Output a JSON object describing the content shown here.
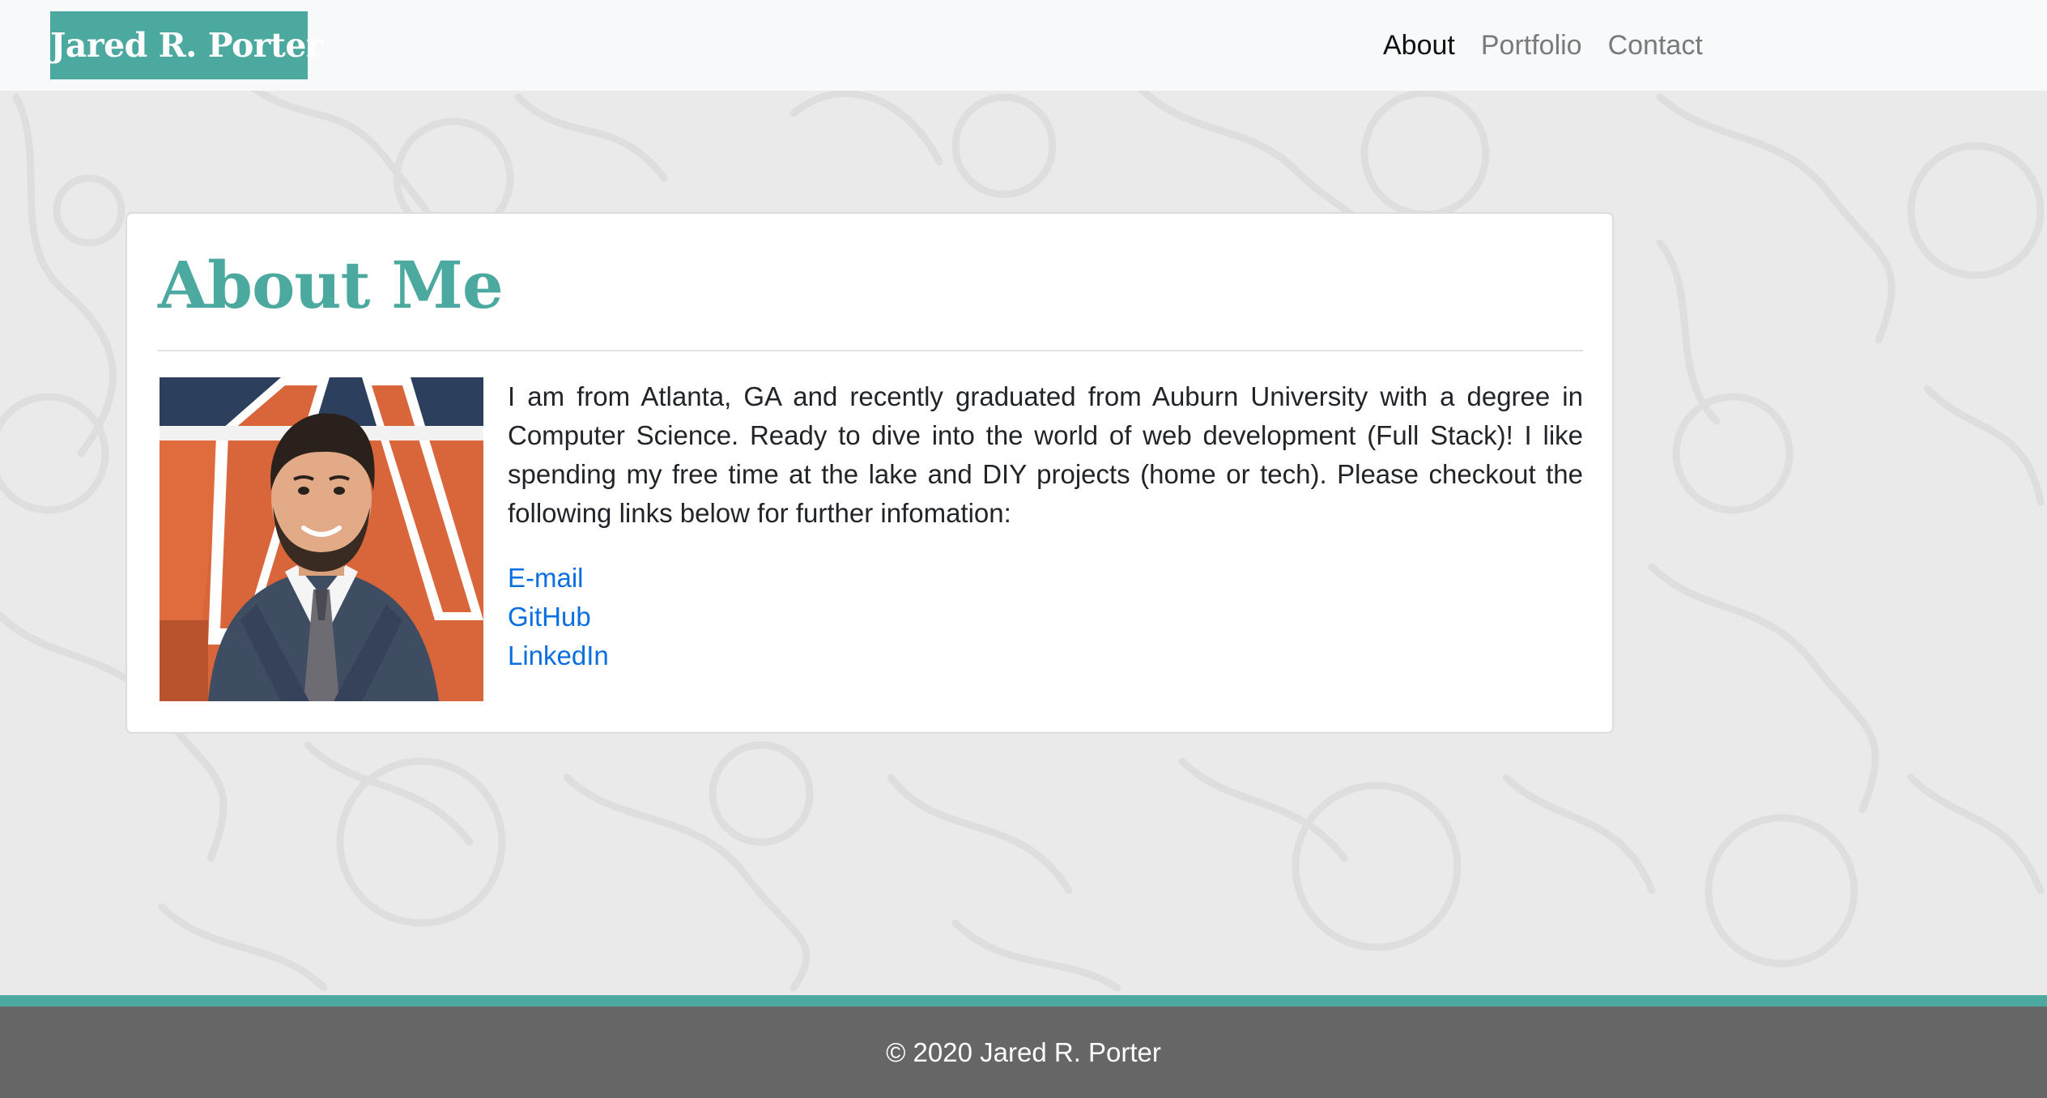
{
  "navbar": {
    "brand": "Jared R. Porter",
    "links": [
      {
        "label": "About",
        "active": true
      },
      {
        "label": "Portfolio",
        "active": false
      },
      {
        "label": "Contact",
        "active": false
      }
    ]
  },
  "about": {
    "title": "About Me",
    "bio": "I am from Atlanta, GA and recently graduated from Auburn University with a degree in Computer Science. Ready to dive into the world of web development (Full Stack)! I like spending my free time at the lake and DIY projects (home or tech). Please checkout the following links below for further infomation:",
    "links": [
      {
        "label": "E-mail"
      },
      {
        "label": "GitHub"
      },
      {
        "label": "LinkedIn"
      }
    ]
  },
  "footer": {
    "copyright": "© 2020 Jared R. Porter"
  },
  "colors": {
    "accent": "#4ca9a0",
    "link": "#0a6fe0",
    "footer_bg": "#666666",
    "page_bg": "#eaeaea"
  }
}
